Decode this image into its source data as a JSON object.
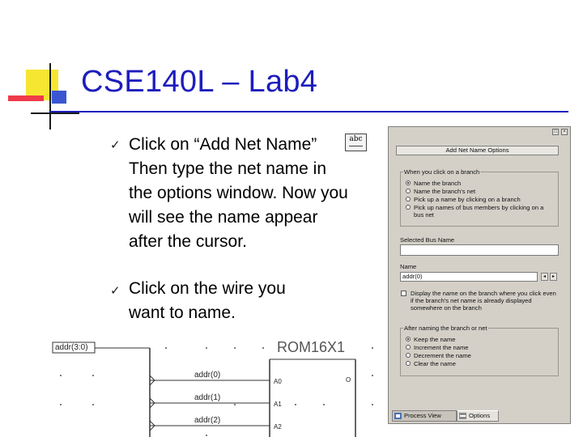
{
  "slide": {
    "title": "CSE140L – Lab4",
    "bullets": [
      "Click on “Add Net Name” Then type the net name in the options window. Now you will see the name appear after the cursor.",
      "Click on the wire you want to name."
    ],
    "bullet_glyph": "ü",
    "add_net_icon_text": "abc"
  },
  "schematic": {
    "bus_label": "addr(3:0)",
    "chip_name": "ROM16X1",
    "net_labels": [
      "addr(0)",
      "addr(1)",
      "addr(2)"
    ],
    "pin_labels": [
      "A0",
      "A1",
      "A2"
    ],
    "output_pin": "O"
  },
  "options_window": {
    "header": "Add Net Name Options",
    "branch_group": {
      "label": "When you click on a branch",
      "options": [
        "Name the branch",
        "Name the branch's net",
        "Pick up a name by clicking on a branch",
        "Pick up names of bus members by clicking on a bus net"
      ],
      "selected_index": 0
    },
    "selected_bus_name_label": "Selected Bus Name",
    "selected_bus_name_value": "",
    "name_label": "Name",
    "name_value": "addr(0)",
    "display_checkbox_text": "Display the name on the branch where you click even if the branch's net name is already displayed somewhere on the branch",
    "display_checked": false,
    "after_group": {
      "label": "After naming the branch or net",
      "options": [
        "Keep the name",
        "Increment the name",
        "Decrement the name",
        "Clear the name"
      ],
      "selected_index": 0
    },
    "tabs": [
      "Process View",
      "Options"
    ],
    "active_tab": 1
  }
}
